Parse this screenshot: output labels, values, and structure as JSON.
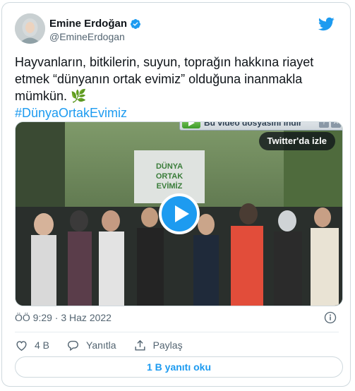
{
  "author": {
    "name": "Emine Erdoğan",
    "handle": "@EmineErdogan"
  },
  "tweet": {
    "text": "Hayvanların, bitkilerin, suyun, toprağın hakkına riayet etmek “dünyanın ortak evimiz” olduğuna inanmakla mümkün. 🌿",
    "hashtag": "#DünyaOrtakEvimiz"
  },
  "media": {
    "download_bar_label": "Bu video dosyasını indir",
    "download_help": "?",
    "download_close": "✕",
    "watch_label": "Twitter'da izle",
    "sign_text": "DÜNYA ORTAK EVİMİZ"
  },
  "timestamp": "ÖÖ 9:29 · 3 Haz 2022",
  "actions": {
    "like_count": "4 B",
    "reply_label": "Yanıtla",
    "share_label": "Paylaş"
  },
  "read_replies_label": "1 B yanıtı oku",
  "colors": {
    "accent": "#1d9bf0",
    "text_primary": "#0f1419",
    "text_secondary": "#536471"
  }
}
